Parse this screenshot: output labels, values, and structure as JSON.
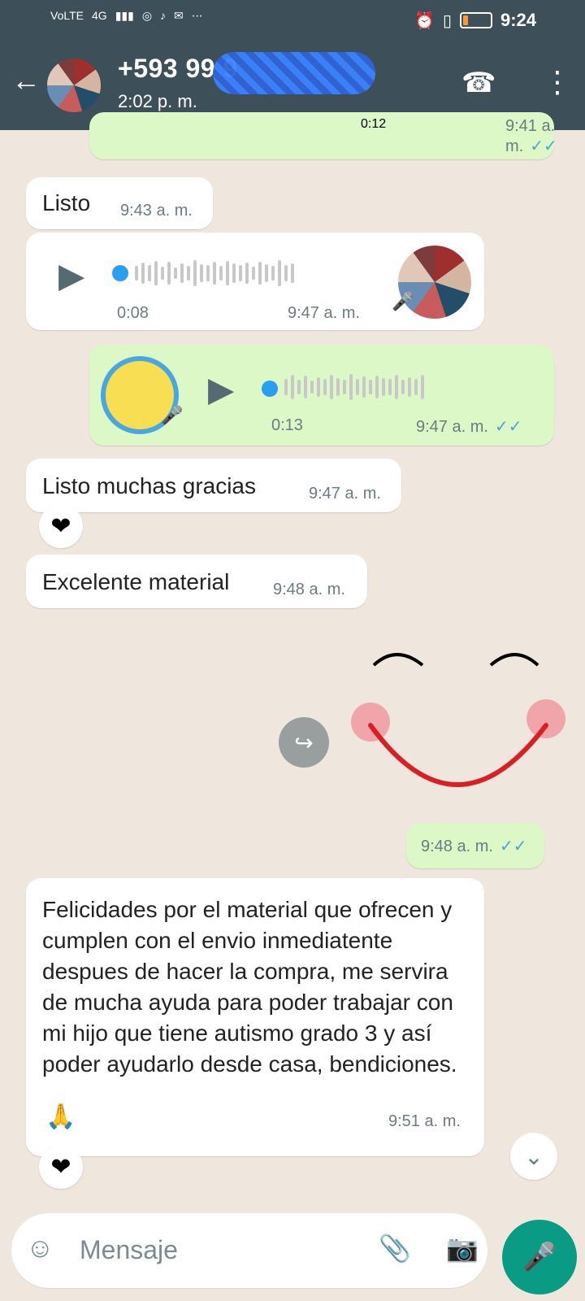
{
  "status_bar": {
    "time": "9:24",
    "left_items": [
      "Vo LTE",
      "4G",
      "signal",
      "notification",
      "instagram",
      "tiktok",
      "mail",
      "more"
    ]
  },
  "header": {
    "contact": "+593 99 9",
    "subtitle": "2:02 p. m."
  },
  "chat": {
    "top_voice": {
      "duration": "0:12",
      "time": "9:41 a. m."
    },
    "messages": [
      {
        "id": "m1",
        "type": "text",
        "text": "Listo",
        "time": "9:43 a. m.",
        "out": false
      },
      {
        "id": "m2",
        "type": "voice",
        "duration": "0:08",
        "time": "9:47 a. m.",
        "out": false
      },
      {
        "id": "m3",
        "type": "voice",
        "duration": "0:13",
        "time": "9:47 a. m.",
        "out": true
      },
      {
        "id": "m4",
        "type": "text",
        "text": "Listo muchas gracias",
        "time": "9:47 a. m.",
        "out": false
      },
      {
        "id": "m5",
        "type": "text",
        "text": "Excelente material",
        "time": "9:48 a. m.",
        "out": false
      },
      {
        "id": "m6",
        "type": "sticker",
        "time": "9:48 a. m.",
        "out": true
      },
      {
        "id": "m7",
        "type": "text",
        "text": "Felicidades por el material que ofrecen y cumplen con el envio inmediatente despues de hacer la compra, me servira de mucha ayuda para poder trabajar con mi hijo que tiene autismo grado 3 y así poder ayudarlo desde casa, bendiciones.",
        "time": "9:51 a. m.",
        "out": false
      }
    ]
  },
  "composer": {
    "placeholder": "Mensaje"
  },
  "colors": {
    "header": "#3d4f58",
    "outgoing": "#dcf8c6",
    "incoming": "#ffffff",
    "accent": "#0a9b84",
    "check": "#4aa3d9"
  },
  "icons": {
    "back": "back-icon",
    "call": "call-add-icon",
    "menu": "menu-icon",
    "emoji": "emoji-icon",
    "attachment": "attachment-icon",
    "camera": "camera-icon",
    "mic": "mic-icon",
    "forward": "forward-icon",
    "scroll": "chevron-down-icon"
  }
}
